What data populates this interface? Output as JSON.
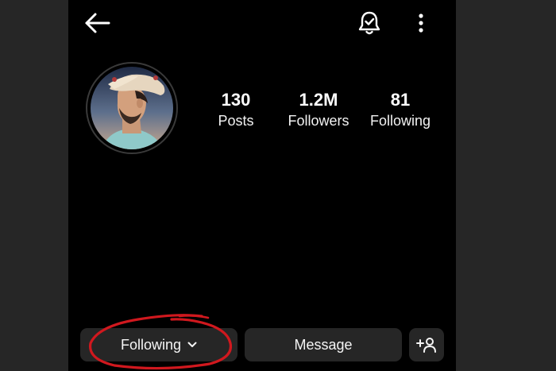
{
  "header": {
    "back_icon": "arrow-left-icon",
    "notification_icon": "bell-check-icon",
    "more_icon": "vertical-ellipsis-icon"
  },
  "profile": {
    "avatar_alt": "profile-photo"
  },
  "stats": [
    {
      "value": "130",
      "label": "Posts"
    },
    {
      "value": "1.2M",
      "label": "Followers"
    },
    {
      "value": "81",
      "label": "Following"
    }
  ],
  "actions": {
    "following_label": "Following",
    "message_label": "Message",
    "suggest_icon": "add-person-icon"
  },
  "colors": {
    "background": "#000000",
    "button_bg": "#262626",
    "annotation": "#d0181e",
    "text": "#ffffff"
  }
}
